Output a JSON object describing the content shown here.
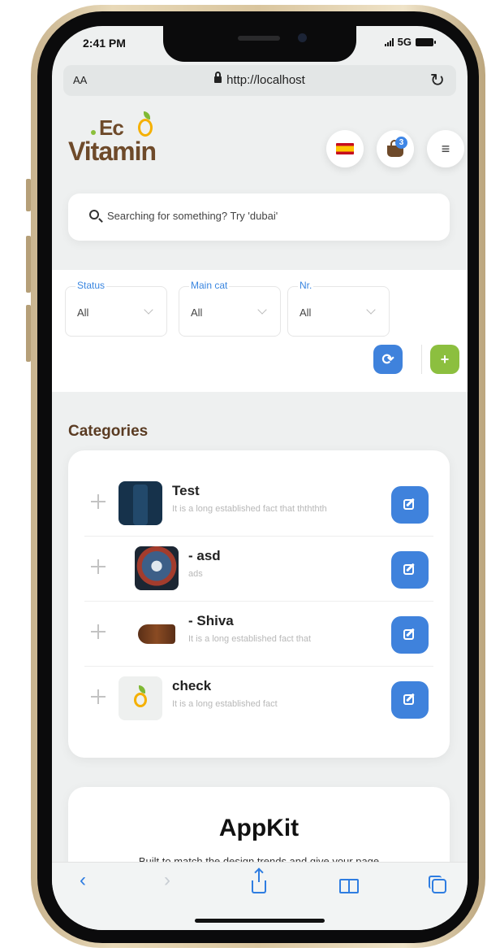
{
  "status_bar": {
    "time": "2:41 PM",
    "network": "5G"
  },
  "browser": {
    "aa_label": "AA",
    "url": "http://localhost"
  },
  "header": {
    "logo_top": "Ec",
    "logo_bottom": "Vitamin",
    "cart_count": "3",
    "language_icon": "spain-flag-icon",
    "menu_icon": "hamburger-menu-icon"
  },
  "search": {
    "placeholder": "Searching for something? Try 'dubai'"
  },
  "filters": [
    {
      "label": "Status",
      "value": "All"
    },
    {
      "label": "Main cat",
      "value": "All"
    },
    {
      "label": "Nr.",
      "value": "All"
    }
  ],
  "colors": {
    "accent_blue": "#3f82dc",
    "accent_green": "#8cbf3f",
    "brand_brown": "#6e4a2a"
  },
  "categories": {
    "title": "Categories",
    "items": [
      {
        "name": "Test",
        "description": "It is a long established fact that thththth"
      },
      {
        "name": "- asd",
        "description": "ads"
      },
      {
        "name": "- Shiva",
        "description": "It is a long established fact that"
      },
      {
        "name": "check",
        "description": "It is a long established fact"
      }
    ]
  },
  "appkit": {
    "title": "AppKit",
    "subtitle": "Built to match the design trends and give your page"
  }
}
